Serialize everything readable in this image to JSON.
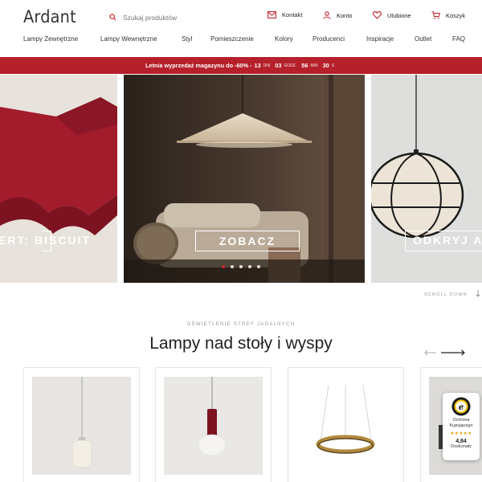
{
  "header": {
    "logo": "Ardant",
    "search_placeholder": "Szukaj produktów",
    "links": {
      "contact": "Kontakt",
      "account": "Konto",
      "favorites": "Ulubione",
      "cart": "Koszyk"
    }
  },
  "nav": [
    "Lampy Zewnętrzne",
    "Lampy Wewnętrzne",
    "Styl",
    "Pomieszczenie",
    "Kolory",
    "Producenci",
    "Inspiracje",
    "Outlet",
    "FAQ"
  ],
  "promo": {
    "text": "Letnia wyprzedaż magazynu do -60% -",
    "days": "13",
    "days_unit": "DNI",
    "hours": "03",
    "hours_unit": "GODZ.",
    "minutes": "56",
    "minutes_unit": "MIN",
    "seconds": "30",
    "seconds_unit": "S"
  },
  "slider": {
    "left_label": "ERT: BISCUIT",
    "center_button": "ZOBACZ",
    "right_label": "ODKRYJ A",
    "slide_count": 5,
    "active_index": 0
  },
  "scroll_down": "SCROLL DOWN",
  "section": {
    "kicker": "OŚWIETLENIE STREF JADALNYCH",
    "title": "Lampy nad stoły i wyspy"
  },
  "colors": {
    "brand_red": "#b5202a",
    "accent": "#c6262e"
  },
  "trust_badge": {
    "icon": "trusted-shops-icon",
    "title": "Ochrona Kupującego",
    "stars": "★★★★★",
    "score": "4,84",
    "label": "Doskonały"
  }
}
